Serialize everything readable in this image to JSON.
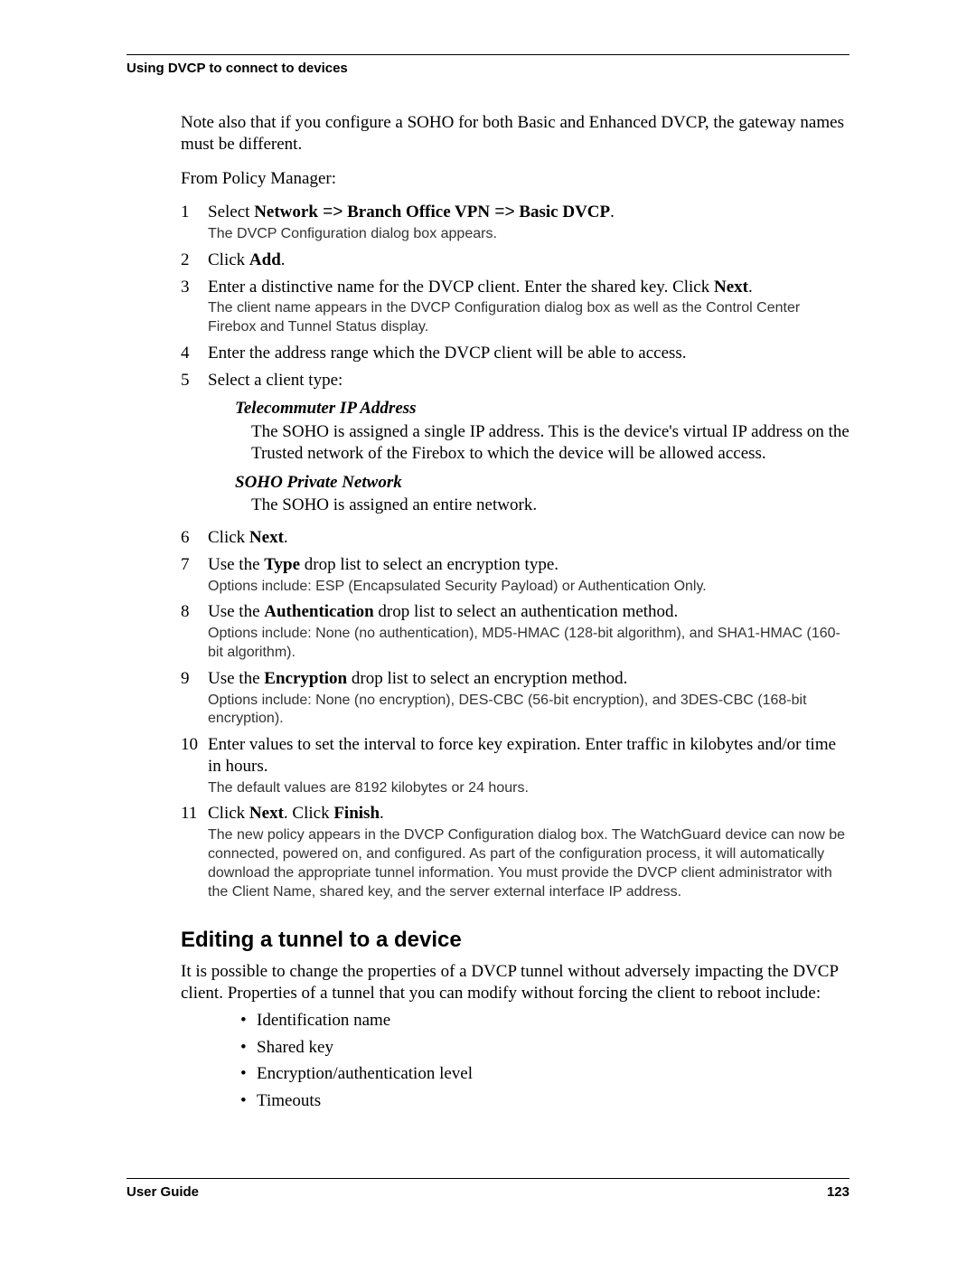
{
  "header": {
    "section": "Using DVCP to connect to devices"
  },
  "intro": {
    "note": "Note also that if you configure a SOHO for both Basic and Enhanced DVCP, the gateway names must be different.",
    "from": "From Policy Manager:"
  },
  "steps": {
    "s1_pre": "Select ",
    "s1_b1": "Network",
    "s1_arr": " =>",
    "s1_b2": "Branch Office VPN",
    "s1_b3": "Basic DVCP",
    "s1_period": ".",
    "s1_note": "The DVCP Configuration dialog box appears.",
    "s2_pre": "Click ",
    "s2_b": "Add",
    "s3_main": "Enter a distinctive name for the DVCP client. Enter the shared key. Click ",
    "s3_b": "Next",
    "s3_note": "The client name appears in the DVCP Configuration dialog box as well as the Control Center Firebox and Tunnel Status display.",
    "s4": "Enter the address range which the DVCP client will be able to access.",
    "s5": "Select a client type:",
    "s5_t1_title": "Telecommuter IP Address",
    "s5_t1_body": "The SOHO is assigned a single IP address. This is the device's virtual IP address on the Trusted network of the Firebox to which the device will be allowed access.",
    "s5_t2_title": "SOHO Private Network",
    "s5_t2_body": "The SOHO is assigned an entire network.",
    "s6_pre": "Click ",
    "s6_b": "Next",
    "s7_pre": "Use the ",
    "s7_b": "Type",
    "s7_post": " drop list to select an encryption type.",
    "s7_note": "Options include: ESP (Encapsulated Security Payload) or Authentication Only.",
    "s8_pre": "Use the ",
    "s8_b": "Authentication",
    "s8_post": " drop list to select an authentication method.",
    "s8_note": "Options include: None (no authentication), MD5-HMAC (128-bit algorithm), and SHA1-HMAC (160-bit algorithm).",
    "s9_pre": "Use the ",
    "s9_b": "Encryption",
    "s9_post": " drop list to select an encryption method.",
    "s9_note": "Options include: None (no encryption), DES-CBC (56-bit encryption), and 3DES-CBC (168-bit encryption).",
    "s10_main": "Enter values to set the interval to force key expiration. Enter  traffic in kilobytes and/or time in hours.",
    "s10_note": "The default values are 8192 kilobytes or 24 hours.",
    "s11_pre": "Click ",
    "s11_b1": "Next",
    "s11_mid": ". Click ",
    "s11_b2": "Finish",
    "s11_note": "The new policy appears in the DVCP Configuration dialog box. The WatchGuard device can now be connected, powered on, and configured. As part of the configuration process, it will automatically download the appropriate tunnel information. You must provide the DVCP client administrator with the Client Name, shared key, and the server external interface IP address."
  },
  "section2": {
    "title": "Editing a tunnel to a device",
    "intro": "It is possible to change the properties of a DVCP tunnel without adversely impacting the DVCP client. Properties of a tunnel that you can modify without forcing the client to reboot include:",
    "bullets": {
      "b1": "Identification name",
      "b2": "Shared key",
      "b3": "Encryption/authentication level",
      "b4": "Timeouts"
    }
  },
  "footer": {
    "left": "User Guide",
    "right": "123"
  },
  "nums": {
    "n1": "1",
    "n2": "2",
    "n3": "3",
    "n4": "4",
    "n5": "5",
    "n6": "6",
    "n7": "7",
    "n8": "8",
    "n9": "9",
    "n10": "10",
    "n11": "11"
  }
}
